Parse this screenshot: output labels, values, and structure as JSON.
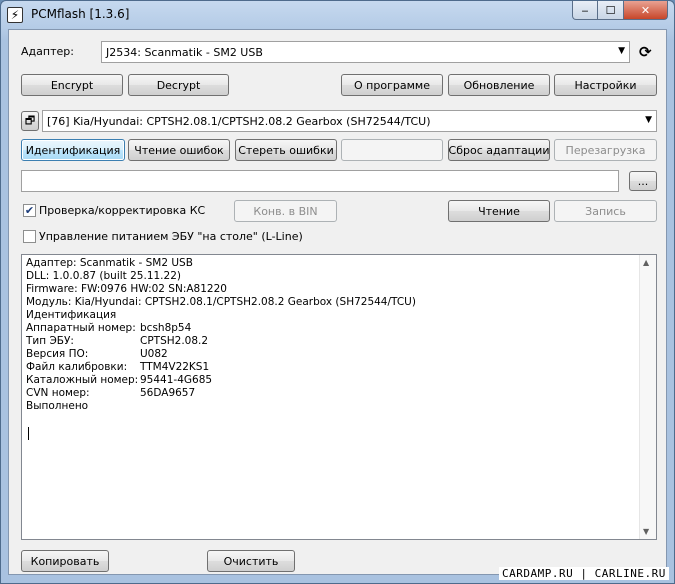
{
  "window": {
    "title": "PCMflash [1.3.6]",
    "app_icon": "lightning-icon",
    "controls": {
      "minimize": "‒",
      "maximize": "☐",
      "close": "✕"
    }
  },
  "adapter": {
    "label": "Адаптер:",
    "value": "J2534: Scanmatik - SM2 USB",
    "refresh_icon": "refresh-icon"
  },
  "toolbar1": {
    "encrypt": "Encrypt",
    "decrypt": "Decrypt",
    "about": "О программе",
    "update": "Обновление",
    "settings": "Настройки"
  },
  "module": {
    "icon": "window-icon",
    "value": "[76] Kia/Hyundai: CPTSH2.08.1/CPTSH2.08.2 Gearbox (SH72544/TCU)"
  },
  "toolbar2": {
    "identify": "Идентификация",
    "read_errors": "Чтение ошибок",
    "clear_errors": "Стереть ошибки",
    "empty": "",
    "reset_adaptation": "Сброс адаптации",
    "reboot": "Перезагрузка"
  },
  "file": {
    "path": "",
    "browse": "..."
  },
  "options": {
    "checksum_label": "Проверка/корректировка КС",
    "checksum_checked": true,
    "convert_bin": "Конв. в BIN",
    "read": "Чтение",
    "write": "Запись",
    "power_label": "Управление питанием ЭБУ \"на столе\" (L-Line)",
    "power_checked": false
  },
  "log": {
    "lines": [
      "Адаптер: Scanmatik - SM2 USB",
      "DLL: 1.0.0.87 (built 25.11.22)",
      "Firmware: FW:0976 HW:02 SN:A81220",
      "Модуль: Kia/Hyundai: CPTSH2.08.1/CPTSH2.08.2 Gearbox (SH72544/TCU)",
      "Идентификация"
    ],
    "fields": [
      {
        "k": "Аппаратный номер:",
        "v": "bcsh8p54"
      },
      {
        "k": "Тип ЭБУ:",
        "v": "CPTSH2.08.2"
      },
      {
        "k": "Версия ПО:",
        "v": "U082"
      },
      {
        "k": "Файл калибровки:",
        "v": "TTM4V22KS1"
      },
      {
        "k": "Каталожный номер:",
        "v": "95441-4G685"
      },
      {
        "k": "CVN номер:",
        "v": "56DA9657"
      }
    ],
    "done": "Выполнено"
  },
  "bottom": {
    "copy": "Копировать",
    "clear": "Очистить"
  },
  "watermark": "CARDAMP.RU | CARLINE.RU"
}
